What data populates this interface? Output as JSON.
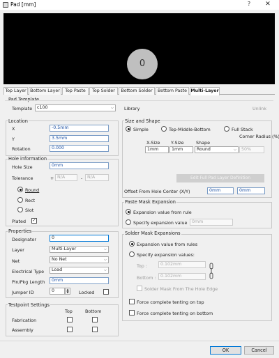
{
  "window": {
    "title": "Pad [mm]",
    "help": "?",
    "close": "✕"
  },
  "preview": {
    "pad_label": "0"
  },
  "tabs": [
    "Top Layer",
    "Bottom Layer",
    "Top Paste",
    "Top Solder",
    "Bottom Solder",
    "Bottom Paste",
    "Multi-Layer"
  ],
  "pad_template": {
    "heading": "Pad Template",
    "template_label": "Template",
    "template_value": "c100",
    "library_label": "Library",
    "unlink_label": "Unlink"
  },
  "location": {
    "heading": "Location",
    "x_label": "X",
    "x_value": "-0.5mm",
    "y_label": "Y",
    "y_value": "3.5mm",
    "rotation_label": "Rotation",
    "rotation_value": "0.000"
  },
  "hole": {
    "heading": "Hole information",
    "size_label": "Hole Size",
    "size_value": "0mm",
    "tolerance_label": "Tolerance",
    "plus": "+",
    "tol_plus": "N/A",
    "minus": "-",
    "tol_minus": "N/A",
    "round": "Round",
    "rect": "Rect",
    "slot": "Slot",
    "plated_label": "Plated",
    "plated_check": "✓"
  },
  "properties": {
    "heading": "Properties",
    "designator_label": "Designator",
    "designator_value": "0",
    "layer_label": "Layer",
    "layer_value": "Multi-Layer",
    "net_label": "Net",
    "net_value": "No Net",
    "etype_label": "Electrical Type",
    "etype_value": "Load",
    "pinpkg_label": "Pin/Pkg Length",
    "pinpkg_value": "0mm",
    "jumper_label": "Jumper ID",
    "jumper_value": "0",
    "locked_label": "Locked"
  },
  "testpoint": {
    "heading": "Testpoint Settings",
    "top": "Top",
    "bottom": "Bottom",
    "fabrication": "Fabrication",
    "assembly": "Assembly"
  },
  "size_shape": {
    "heading": "Size and Shape",
    "simple": "Simple",
    "tmb": "Top-Middle-Bottom",
    "full": "Full Stack",
    "col_xsize": "X-Size",
    "col_ysize": "Y-Size",
    "col_shape": "Shape",
    "col_corner": "Corner Radius (%)",
    "xsize": "1mm",
    "ysize": "1mm",
    "shape": "Round",
    "corner": "50%",
    "edit_full": "Edit Full Pad Layer Definition",
    "offset_label": "Offset From Hole Center (X/Y)",
    "offset_x": "0mm",
    "offset_y": "0mm"
  },
  "paste_mask": {
    "heading": "Paste Mask Expansion",
    "rule": "Expansion value from rule",
    "specify": "Specify expansion value",
    "value": "0mm"
  },
  "solder_mask": {
    "heading": "Solder Mask Expansions",
    "rules": "Expansion value from rules",
    "specify": "Specify expansion values:",
    "top_label": "Top :",
    "top_value": "0.102mm",
    "bottom_label": "Bottom :",
    "bottom_value": "0.102mm",
    "from_hole": "Solder Mask From The Hole Edge",
    "tent_top": "Force complete tenting on top",
    "tent_bottom": "Force complete tenting on bottom"
  },
  "footer": {
    "ok": "OK",
    "cancel": "Cancel"
  }
}
